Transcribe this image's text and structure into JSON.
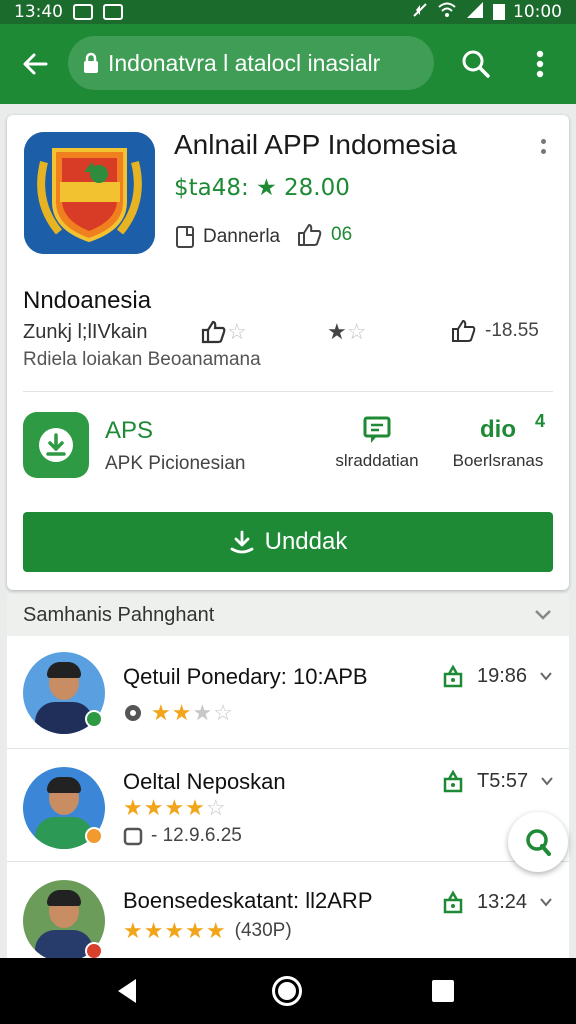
{
  "status_bar": {
    "time_left": "13:40",
    "time_right": "10:00"
  },
  "toolbar": {
    "url": "Indonatvra l atalocl inasialr"
  },
  "app": {
    "title": "Anlnail APP Indomesia",
    "price": "$ta48: ★ 28.00",
    "meta_label": "Dannerla",
    "meta_count": "06",
    "developer": "Nndoanesia",
    "developer_sub": "Zunkj l;lIVkain",
    "developer_sub2": "Rdiela loiakan Beoanamana",
    "rating_count": "-18.55"
  },
  "apk": {
    "title": "APS",
    "subtitle": "APK Picionesian",
    "action1_label": "slraddatian",
    "action2_label": "Boerlsranas",
    "action2_icon_text": "dio",
    "badge": "4",
    "install_label": "Unddak"
  },
  "section": {
    "title": "Samhanis Pahnghant"
  },
  "list": [
    {
      "title": "Qetuil Ponedary: 10:APB",
      "sub": "",
      "stars": 3,
      "time": "19:86",
      "badge_color": "#2e9a43"
    },
    {
      "title": "Oeltal Neposkan",
      "sub": "- 12.9.6.25",
      "stars": 4,
      "time": "T5:57",
      "badge_color": "#f29a2e"
    },
    {
      "title": "Boensedeskatant: ll2ARP",
      "sub": "(430P)",
      "stars": 5,
      "time": "13:24",
      "badge_color": "#d9402b"
    }
  ],
  "colors": {
    "primary": "#1e8a36",
    "primary_dark": "#1b6b2c",
    "star": "#f2a51a"
  }
}
